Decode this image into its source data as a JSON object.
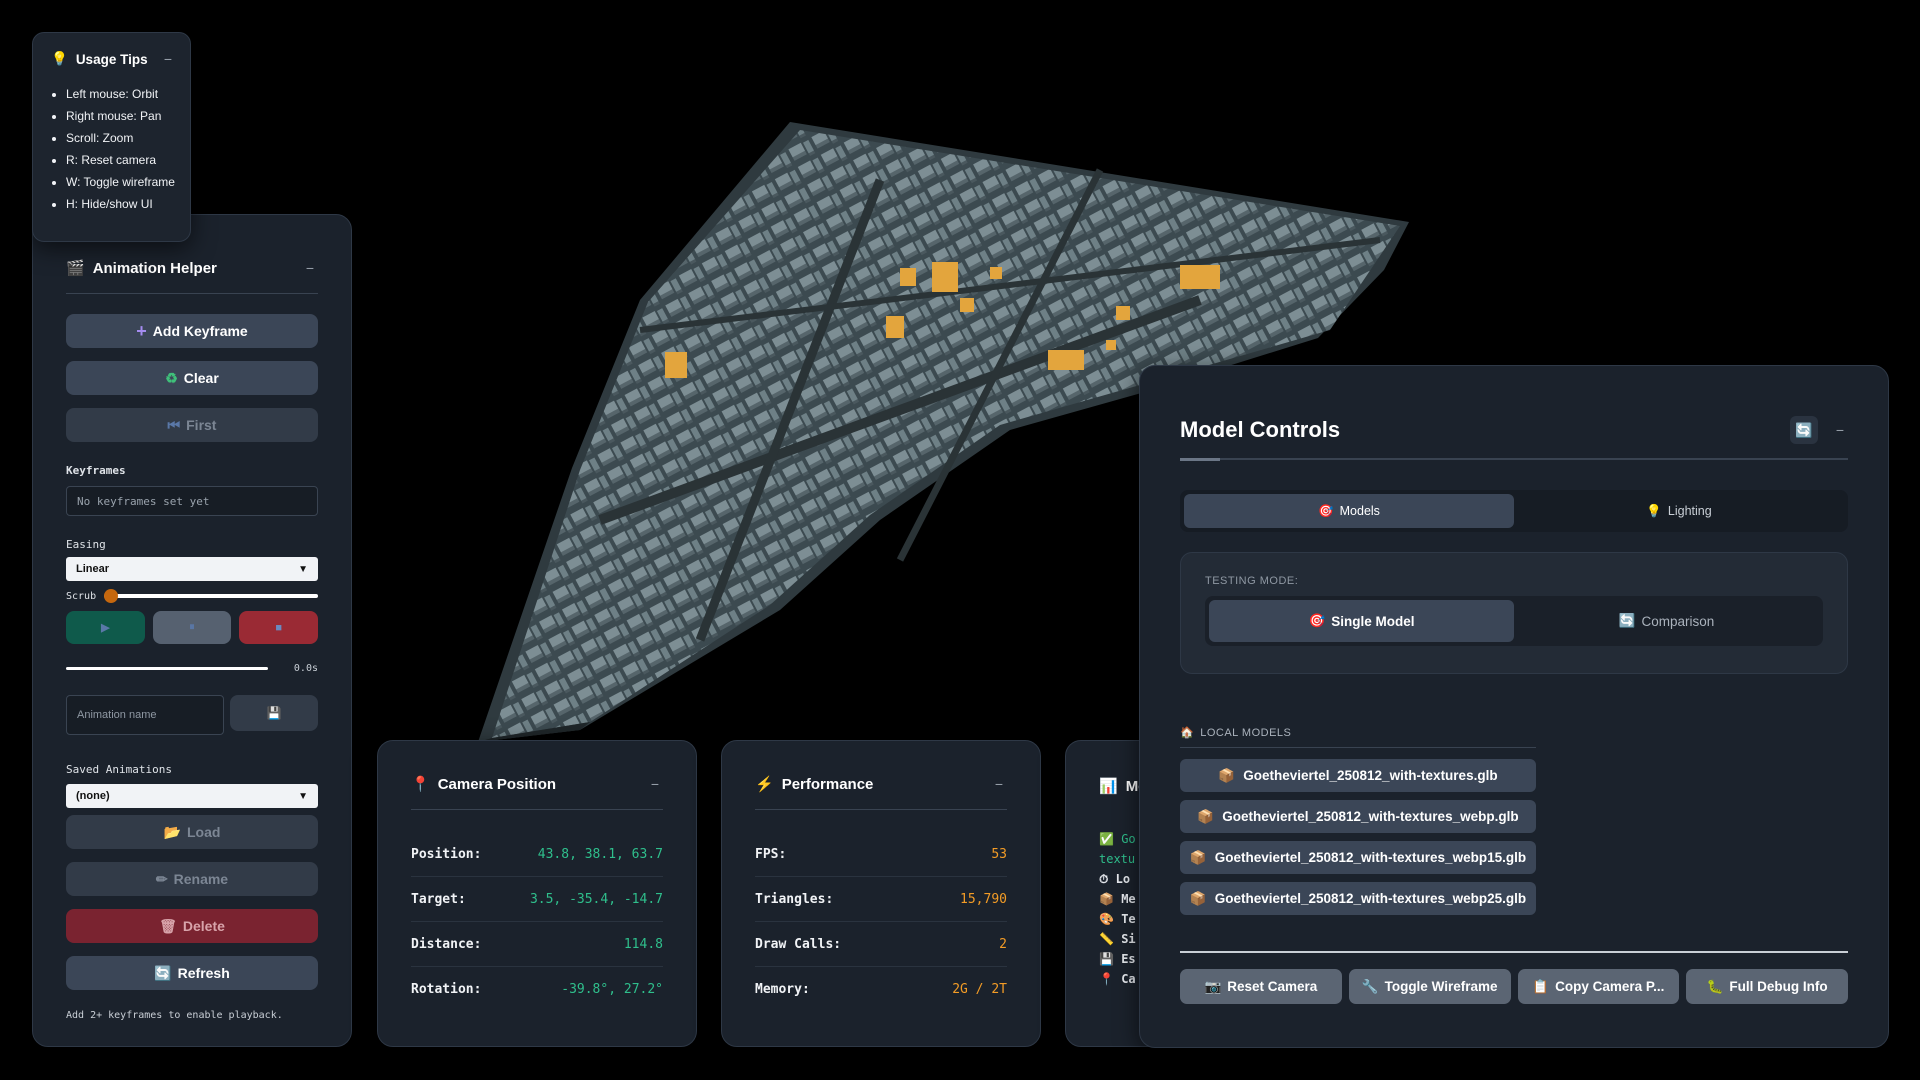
{
  "usage_tips": {
    "title": "Usage Tips",
    "items": [
      "Left mouse: Orbit",
      "Right mouse: Pan",
      "Scroll: Zoom",
      "R: Reset camera",
      "W: Toggle wireframe",
      "H: Hide/show UI"
    ]
  },
  "animation": {
    "title": "Animation Helper",
    "add_keyframe": "Add Keyframe",
    "clear": "Clear",
    "first": "First",
    "keyframes_label": "Keyframes",
    "keyframes_empty": "No keyframes set yet",
    "easing_label": "Easing",
    "easing_value": "Linear",
    "scrub_label": "Scrub",
    "scrub_value": 0,
    "time": "0.0s",
    "name_placeholder": "Animation name",
    "saved_label": "Saved Animations",
    "saved_value": "(none)",
    "load": "Load",
    "rename": "Rename",
    "delete": "Delete",
    "refresh": "Refresh",
    "hint": "Add 2+ keyframes to enable playback."
  },
  "camera": {
    "title": "Camera Position",
    "rows": [
      {
        "k": "Position:",
        "v": "43.8, 38.1, 63.7"
      },
      {
        "k": "Target:",
        "v": "3.5, -35.4, -14.7"
      },
      {
        "k": "Distance:",
        "v": "114.8"
      },
      {
        "k": "Rotation:",
        "v": "-39.8°, 27.2°"
      }
    ]
  },
  "performance": {
    "title": "Performance",
    "rows": [
      {
        "k": "FPS:",
        "v": "53"
      },
      {
        "k": "Triangles:",
        "v": "15,790"
      },
      {
        "k": "Draw Calls:",
        "v": "2"
      },
      {
        "k": "Memory:",
        "v": "2G / 2T"
      }
    ]
  },
  "model_info": {
    "title": "Mo",
    "lines": [
      "Go",
      "textu",
      "Lo",
      "Me",
      "Te",
      "Si",
      "Es",
      "Ca"
    ]
  },
  "model_controls": {
    "title": "Model Controls",
    "tabs": [
      {
        "label": "Models"
      },
      {
        "label": "Lighting"
      }
    ],
    "testing_mode_label": "TESTING MODE:",
    "modes": [
      {
        "label": "Single Model"
      },
      {
        "label": "Comparison"
      }
    ],
    "local_models_label": "LOCAL MODELS",
    "models": [
      "Goetheviertel_250812_with-textures.glb",
      "Goetheviertel_250812_with-textures_webp.glb",
      "Goetheviertel_250812_with-textures_webp15.glb",
      "Goetheviertel_250812_with-textures_webp25.glb"
    ],
    "footer": [
      "Reset Camera",
      "Toggle Wireframe",
      "Copy Camera P...",
      "Full Debug Info"
    ]
  },
  "colors": {
    "green": "#2fbf8c",
    "orange": "#f39c26",
    "accent": "#3b4657"
  }
}
